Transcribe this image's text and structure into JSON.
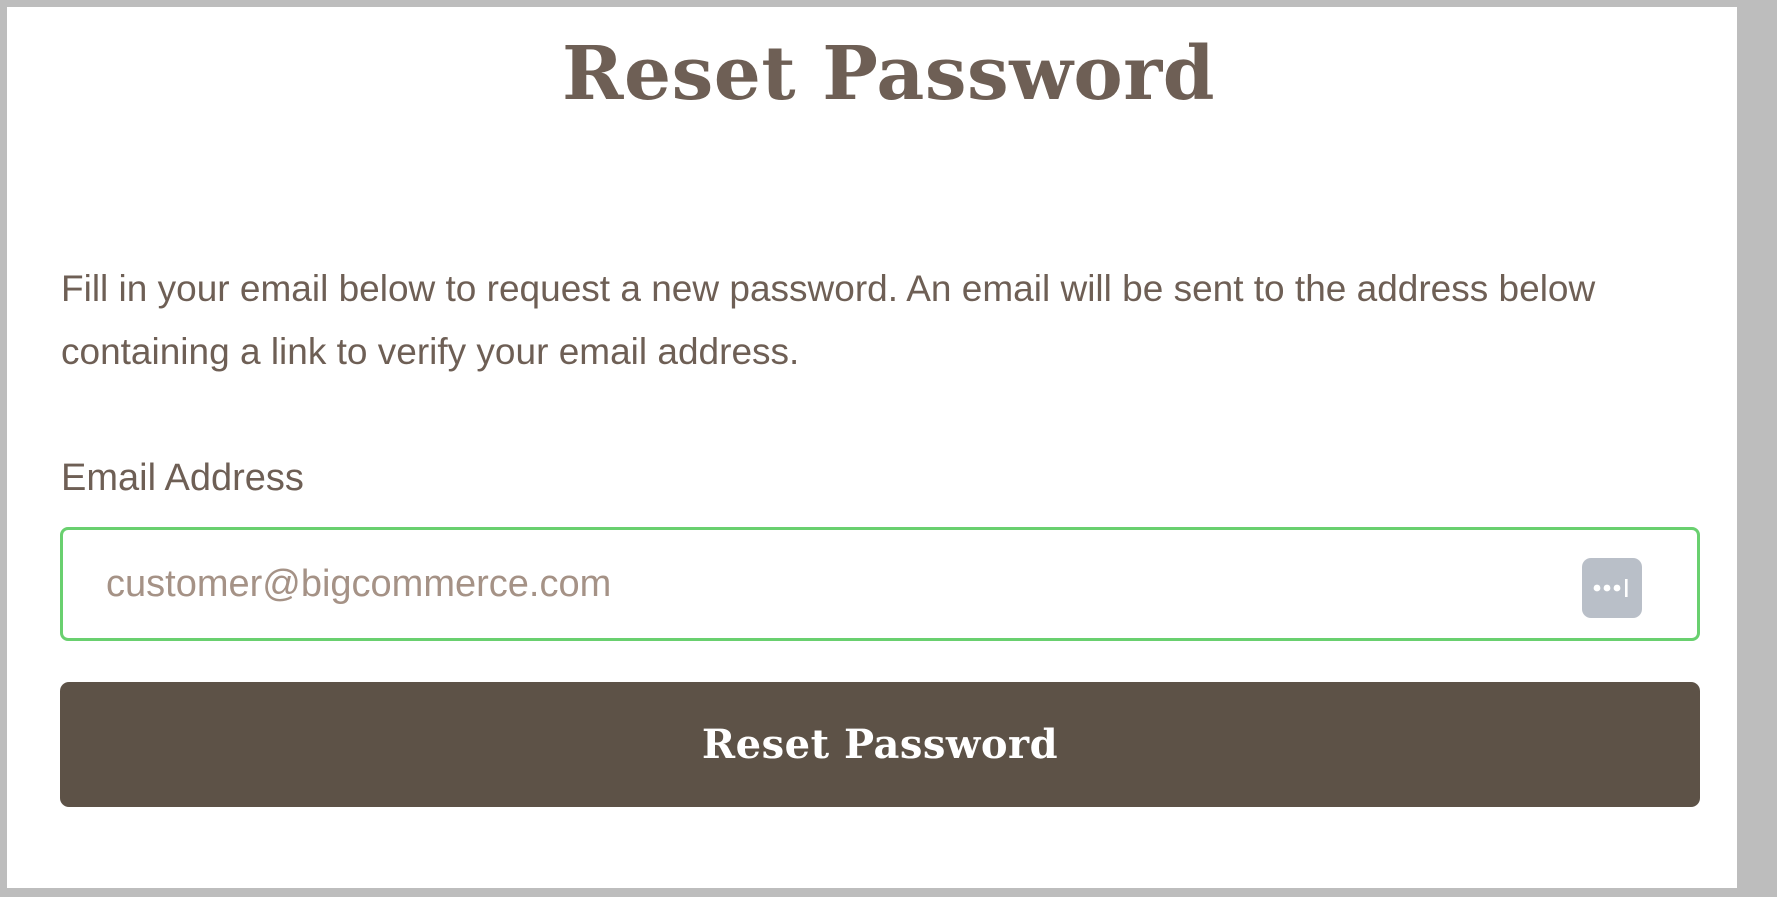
{
  "page": {
    "title": "Reset Password",
    "instructions": "Fill in your email below to request a new password. An email will be sent to the address below containing a link to verify your email address."
  },
  "form": {
    "email_label": "Email Address",
    "email_value": "",
    "email_placeholder": "customer@bigcommerce.com",
    "password_manager_icon": "password-manager-icon",
    "submit_label": "Reset Password"
  },
  "colors": {
    "text": "#6e5f55",
    "placeholder": "#a59286",
    "input_focus_border": "#69d06f",
    "button_background": "#5d5247",
    "button_text": "#ffffff",
    "icon_background": "#b9bfc8"
  }
}
